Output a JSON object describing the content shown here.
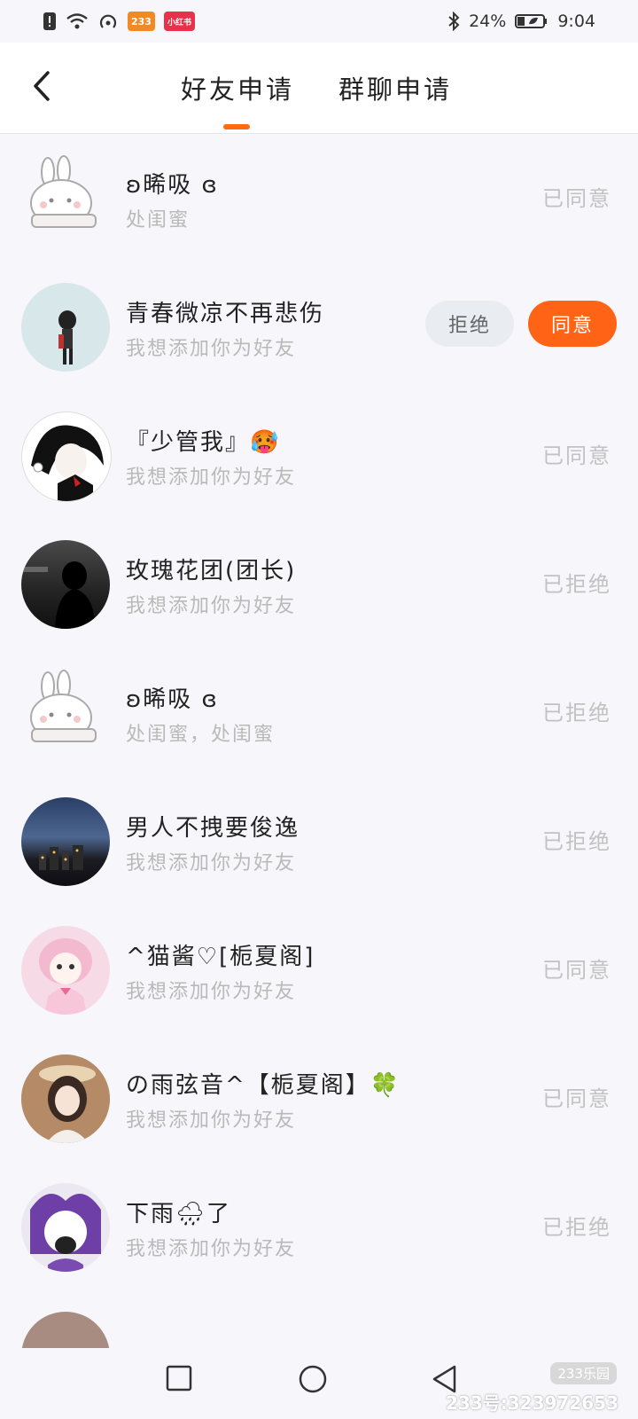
{
  "status_bar": {
    "battery": "24%",
    "time": "9:04",
    "app_badge_1": "233",
    "app_badge_2": "小红书"
  },
  "header": {
    "tabs": [
      {
        "label": "好友申请",
        "active": true
      },
      {
        "label": "群聊申请",
        "active": false
      }
    ],
    "accent_color": "#ff6a13"
  },
  "requests": [
    {
      "name": "ʚ晞吸 ɞ",
      "message": "处闺蜜",
      "status": "已同意"
    },
    {
      "name": "青春微凉不再悲伤",
      "message": "我想添加你为好友",
      "status": "",
      "actions": {
        "reject": "拒绝",
        "accept": "同意"
      }
    },
    {
      "name": "『少管我』🥵",
      "message": "我想添加你为好友",
      "status": "已同意"
    },
    {
      "name": "玫瑰花团(团长)",
      "message": "我想添加你为好友",
      "status": "已拒绝"
    },
    {
      "name": "ʚ晞吸 ɞ",
      "message": "处闺蜜，处闺蜜",
      "status": "已拒绝"
    },
    {
      "name": "男人不拽要俊逸",
      "message": "我想添加你为好友",
      "status": "已拒绝"
    },
    {
      "name": "^猫酱♡[栀夏阁]",
      "message": "我想添加你为好友",
      "status": "已同意"
    },
    {
      "name": "の雨弦音^【栀夏阁】🍀",
      "message": "我想添加你为好友",
      "status": "已同意"
    },
    {
      "name": "下雨🌧了",
      "message": "我想添加你为好友",
      "status": "已拒绝"
    }
  ],
  "watermark": {
    "logo": "233乐园",
    "id_text": "233号:323972653"
  }
}
